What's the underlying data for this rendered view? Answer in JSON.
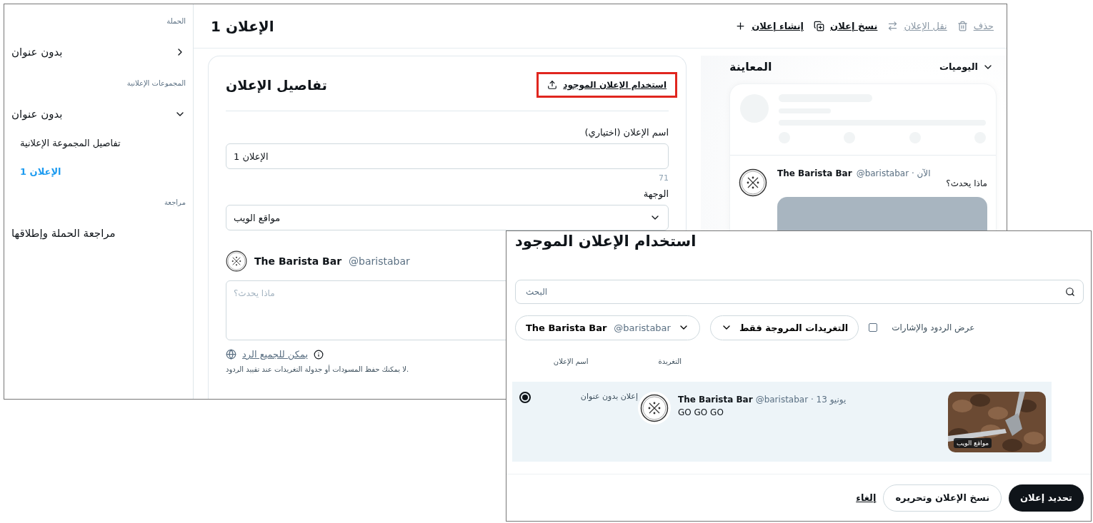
{
  "sidebar": {
    "sections": [
      {
        "label": "الحملة",
        "items": [
          {
            "label": "بدون عنوان",
            "expanded": false,
            "selected": false
          }
        ]
      },
      {
        "label": "المجموعات الإعلانية",
        "items": [
          {
            "label": "بدون عنوان",
            "expanded": true,
            "selected": false,
            "children": [
              {
                "label": "تفاصيل المجموعة الإعلانية",
                "selected": false
              },
              {
                "label": "الإعلان 1",
                "selected": true
              }
            ]
          }
        ]
      },
      {
        "label": "مراجعة",
        "items": [
          {
            "label": "مراجعة الحملة وإطلاقها",
            "selected": false
          }
        ]
      }
    ]
  },
  "header": {
    "title": "الإعلان 1",
    "actions": [
      {
        "label": "حذف",
        "disabled": true
      },
      {
        "label": "نقل الإعلان",
        "disabled": true
      },
      {
        "label": "نسخ إعلان",
        "disabled": false
      },
      {
        "label": "إنشاء إعلان",
        "disabled": false
      }
    ]
  },
  "ad_details": {
    "title": "تفاصيل الإعلان",
    "use_existing": {
      "label": "استخدام الإعلان الموجود",
      "highlighted": true
    },
    "name_field": {
      "label": "اسم الإعلان (اختياري)",
      "value": "الإعلان 1",
      "counter": "71"
    },
    "destination": {
      "label": "الوجهة",
      "value": "مواقع الويب"
    },
    "account": {
      "name": "The Barista Bar",
      "handle": "@baristabar"
    },
    "tweet_field": {
      "placeholder": "ماذا يحدث؟"
    },
    "reply_setting": "يمكن للجميع الرد",
    "note": "لا يمكنك حفظ المسودات أو جدولة التغريدات عند تقييد الردود."
  },
  "preview": {
    "title": "المعاينة",
    "placement": "اليوميات",
    "tweet": {
      "name": "The Barista Bar",
      "meta": "@baristabar · الآن",
      "text": "ماذا يحدث؟"
    }
  },
  "dialog": {
    "title": "استخدام الإعلان الموجود",
    "search": {
      "placeholder": "البحث"
    },
    "account_filter": {
      "name": "The Barista Bar",
      "handle": "@baristabar"
    },
    "type_filter": "التغريدات المروجة فقط",
    "show_replies": {
      "label": "عرض الردود والإشارات",
      "checked": false
    },
    "columns": [
      "التغريدة",
      "اسم الإعلان"
    ],
    "rows": [
      {
        "selected": true,
        "ad_name": "إعلان بدون عنوان",
        "name": "The Barista Bar",
        "meta": "@baristabar · 13 يونيو",
        "text": "GO GO GO",
        "badge": "مواقع الويب"
      }
    ],
    "buttons": [
      {
        "label": "تحديد إعلان",
        "kind": "primary"
      },
      {
        "label": "نسخ الإعلان وتحريره",
        "kind": "secondary"
      },
      {
        "label": "إلغاء",
        "kind": "link"
      }
    ]
  }
}
